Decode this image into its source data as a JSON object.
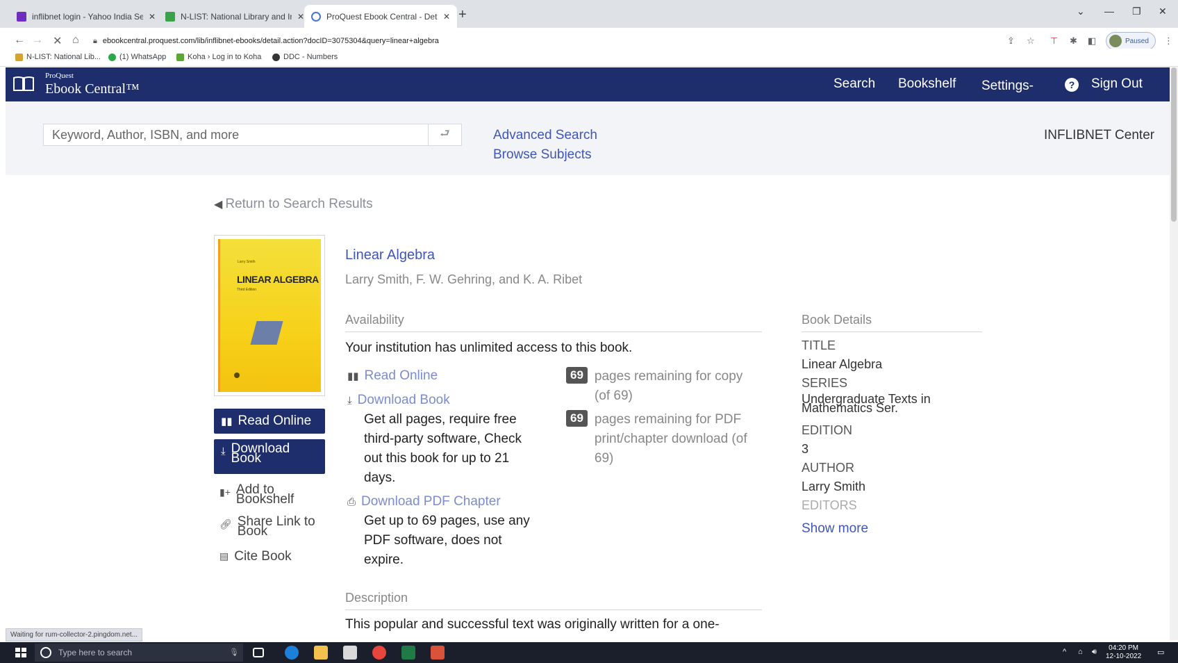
{
  "browser": {
    "tabs": [
      {
        "label": "inflibnet login - Yahoo India Sea",
        "color": "#6f2dbd",
        "active": false
      },
      {
        "label": "N-LIST: National Library and Inf",
        "color": "#3aa34a",
        "active": false
      },
      {
        "label": "ProQuest Ebook Central - Detai",
        "color": "#4a73d1",
        "active": true
      }
    ],
    "new_tab": "+",
    "url": "ebookcentral.proquest.com/lib/inflibnet-ebooks/detail.action?docID=3075304&query=linear+algebra",
    "profile_status": "Paused",
    "bookmarks": [
      {
        "label": "N-LIST: National Lib...",
        "color": "#d6a32c"
      },
      {
        "label": "(1) WhatsApp",
        "color": "#2aa84a"
      },
      {
        "label": "Koha › Log in to Koha",
        "color": "#5aa832"
      },
      {
        "label": "DDC - Numbers",
        "color": "#333333"
      }
    ],
    "status_text": "Waiting for rum-collector-2.pingdom.net..."
  },
  "header": {
    "brand_small": "ProQuest",
    "brand": "Ebook Central™",
    "nav": {
      "search": "Search",
      "bookshelf": "Bookshelf",
      "settings": "Settings-",
      "help": "?",
      "signout": "Sign Out"
    }
  },
  "search": {
    "placeholder": "Keyword, Author, ISBN, and more",
    "go_icon": "⮐",
    "advanced_search": "Advanced Search",
    "browse_subjects": "Browse Subjects",
    "institution": "INFLIBNET Center"
  },
  "return_link": "Return to Search Results",
  "cover": {
    "author": "Larry Smith",
    "title": "LINEAR ALGEBRA",
    "subtitle": "Third Edition"
  },
  "actions": {
    "read_online": "Read Online",
    "download_book": "Download Book",
    "add_bookshelf": "Add to Bookshelf",
    "share_link": "Share Link to Book",
    "cite_book": "Cite Book"
  },
  "book": {
    "title": "Linear Algebra",
    "authors": "Larry Smith, F. W. Gehring, and K. A. Ribet"
  },
  "availability": {
    "heading": "Availability",
    "access_text": "Your institution has unlimited access to this book.",
    "read_online": "Read Online",
    "download_book": "Download Book",
    "download_desc": "Get all pages, require free third-party software, Check out this book for up to 21 days.",
    "download_pdf": "Download PDF Chapter",
    "pdf_desc": "Get up to 69 pages, use any PDF software, does not expire.",
    "copy_count": "69",
    "copy_text": "pages remaining for copy (of 69)",
    "print_count": "69",
    "print_text": "pages remaining for PDF print/chapter download (of 69)"
  },
  "description": {
    "heading": "Description",
    "text": "This popular and successful text was originally written for a one-"
  },
  "details": {
    "heading": "Book Details",
    "title_label": "TITLE",
    "title_value": "Linear Algebra",
    "series_label": "SERIES",
    "series_value": "Undergraduate Texts in Mathematics Ser.",
    "edition_label": "EDITION",
    "edition_value": "3",
    "author_label": "AUTHOR",
    "author_value": "Larry Smith",
    "editors_label": "EDITORS",
    "show_more": "Show more"
  },
  "taskbar": {
    "search_placeholder": "Type here to search",
    "time": "04:20 PM",
    "date": "12-10-2022"
  }
}
